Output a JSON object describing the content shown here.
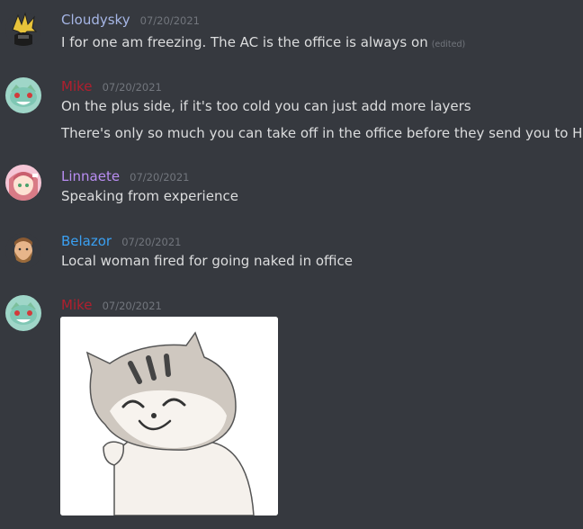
{
  "messages": [
    {
      "username": "Cloudysky",
      "user_color": "#a6b6e6",
      "timestamp": "07/20/2021",
      "avatar_icon": "cloud-strife-avatar",
      "lines": [
        "I for one am freezing. The AC is the office is always on"
      ],
      "edited_label": "(edited)"
    },
    {
      "username": "Mike",
      "user_color": "#b01f2e",
      "timestamp": "07/20/2021",
      "avatar_icon": "bulbasaur-avatar",
      "lines": [
        "On the plus side, if it's too cold you can just add more layers",
        "There's only so much you can take off in the office before they send you to HR"
      ]
    },
    {
      "username": "Linnaete",
      "user_color": "#b98df2",
      "timestamp": "07/20/2021",
      "avatar_icon": "anime-girl-avatar",
      "lines": [
        "Speaking from experience"
      ]
    },
    {
      "username": "Belazor",
      "user_color": "#3aa0f2",
      "timestamp": "07/20/2021",
      "avatar_icon": "bearded-man-avatar",
      "lines": [
        "Local woman fired for going naked in office"
      ]
    },
    {
      "username": "Mike",
      "user_color": "#b01f2e",
      "timestamp": "07/20/2021",
      "avatar_icon": "bulbasaur-avatar",
      "attachment": {
        "type": "image",
        "subject": "smiling-cat-gif"
      }
    }
  ],
  "theme": {
    "background": "#36393f",
    "text": "#dcddde",
    "muted": "#72767d"
  }
}
